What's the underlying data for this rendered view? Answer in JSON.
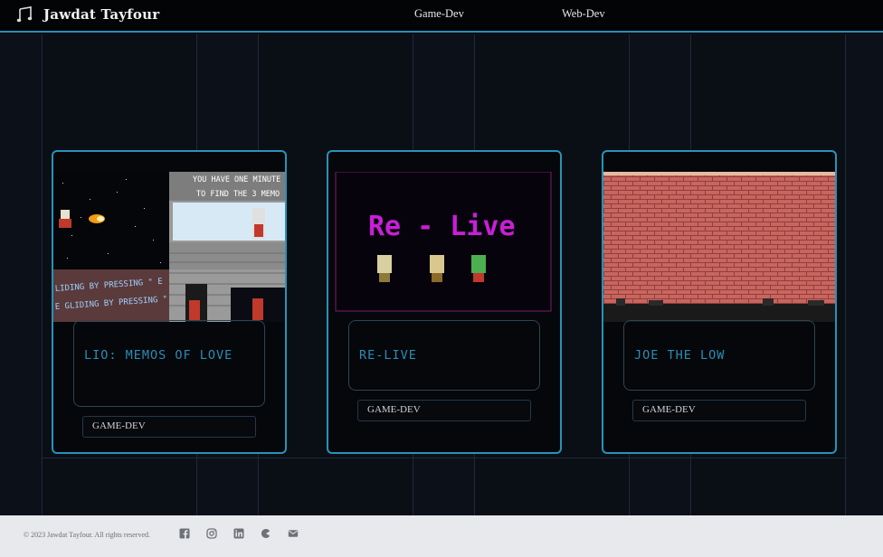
{
  "header": {
    "brand_title": "Jawdat Tayfour",
    "nav": [
      "Game-Dev",
      "Web-Dev"
    ]
  },
  "cards": [
    {
      "title": "LIO: MEMOS OF LOVE",
      "tag": "GAME-DEV",
      "image_text": {
        "line1": "YOU HAVE ONE MINUTE",
        "line2": "TO FIND THE 3 MEMO",
        "scroll1": "LIDING BY PRESSING \" E",
        "scroll2": "E GLIDING BY PRESSING \" E"
      }
    },
    {
      "title": "RE-LIVE",
      "tag": "GAME-DEV",
      "image_text": {
        "logo": "Re - Live"
      }
    },
    {
      "title": "JOE THE LOW",
      "tag": "GAME-DEV"
    }
  ],
  "footer": {
    "copyright": "© 2023 Jawdat Tayfour. All rights reserved.",
    "social_icons": [
      "facebook-icon",
      "instagram-icon",
      "linkedin-icon",
      "itchio-icon",
      "email-icon"
    ]
  },
  "colors": {
    "accent": "#2793b8",
    "title": "#2a8db5",
    "background": "#0b0f17",
    "footer": "#e8e9ec"
  }
}
